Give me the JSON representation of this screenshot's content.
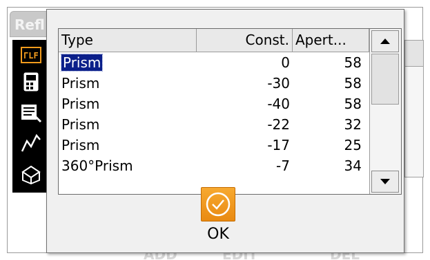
{
  "background_window": {
    "title": "Refl",
    "bottom_labels": [
      "ADD",
      "EDIT",
      "DEL"
    ],
    "sidebar_icons": [
      "rangefinder-icon",
      "instrument-icon",
      "edit-list-icon",
      "survey-graph-icon",
      "prism-box-icon"
    ]
  },
  "dialog": {
    "columns": {
      "type": "Type",
      "const": "Const.",
      "apert": "Apert..."
    },
    "rows": [
      {
        "type": "Prism",
        "const": "0",
        "apert": "58",
        "selected": true
      },
      {
        "type": "Prism",
        "const": "-30",
        "apert": "58",
        "selected": false
      },
      {
        "type": "Prism",
        "const": "-40",
        "apert": "58",
        "selected": false
      },
      {
        "type": "Prism",
        "const": "-22",
        "apert": "32",
        "selected": false
      },
      {
        "type": "Prism",
        "const": "-17",
        "apert": "25",
        "selected": false
      },
      {
        "type": "360°Prism",
        "const": "-7",
        "apert": "34",
        "selected": false
      }
    ],
    "scrollbar": {
      "up_icon": "arrow-up-icon",
      "down_icon": "arrow-down-icon",
      "position_fraction": 0.0
    },
    "ok_button": {
      "label": "OK",
      "icon": "checkmark-circle-icon",
      "color": "#f39c1d"
    }
  },
  "colors": {
    "selection": "#0b1f8a",
    "sidebar": "#000000",
    "accent": "#f39c1d"
  }
}
